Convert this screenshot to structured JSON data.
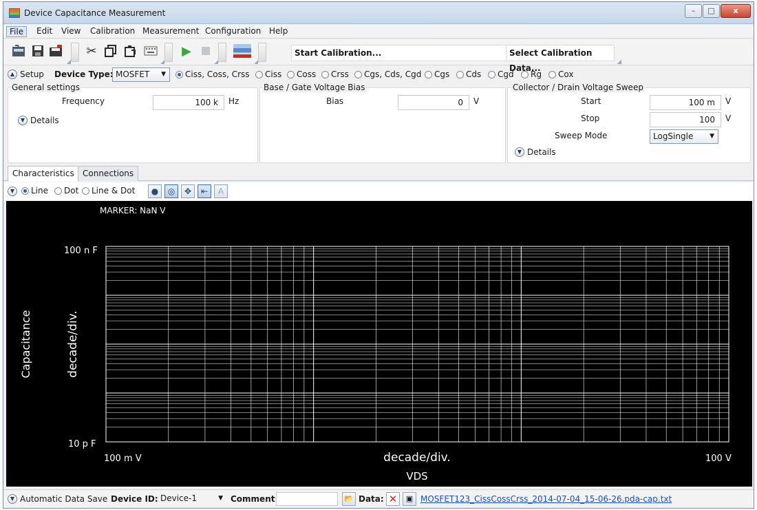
{
  "window": {
    "title": "Device Capacitance Measurement",
    "controls": [
      "–",
      "□",
      "x"
    ]
  },
  "menu": [
    "File",
    "Edit",
    "View",
    "Calibration",
    "Measurement",
    "Configuration",
    "Help"
  ],
  "toolbar": {
    "start_calibration": "Start Calibration...",
    "select_calibration_data": "Select Calibration Data...",
    "icons": [
      "open-folder-icon",
      "save-icon",
      "recent-files-icon",
      "cut-icon",
      "copy-icon",
      "paste-icon",
      "keyboard-icon",
      "run-icon",
      "stop-icon",
      "calibration-icon"
    ]
  },
  "setup": {
    "label": "Setup",
    "device_type_label": "Device Type:",
    "device_type_value": "MOSFET",
    "options": [
      {
        "label": "Ciss, Coss, Crss",
        "selected": true
      },
      {
        "label": "Ciss",
        "selected": false
      },
      {
        "label": "Coss",
        "selected": false
      },
      {
        "label": "Crss",
        "selected": false
      },
      {
        "label": "Cgs, Cds, Cgd",
        "selected": false
      },
      {
        "label": "Cgs",
        "selected": false
      },
      {
        "label": "Cds",
        "selected": false
      },
      {
        "label": "Cgd",
        "selected": false
      },
      {
        "label": "Rg",
        "selected": false
      },
      {
        "label": "Cox",
        "selected": false
      }
    ]
  },
  "general": {
    "title": "General settings",
    "frequency_label": "Frequency",
    "frequency_value": "100 k",
    "frequency_unit": "Hz",
    "details": "Details"
  },
  "bias": {
    "title": "Base / Gate Voltage Bias",
    "bias_label": "Bias",
    "bias_value": "0",
    "bias_unit": "V"
  },
  "sweep": {
    "title": "Collector / Drain Voltage Sweep",
    "start_label": "Start",
    "start_value": "100 m",
    "start_unit": "V",
    "stop_label": "Stop",
    "stop_value": "100",
    "stop_unit": "V",
    "mode_label": "Sweep Mode",
    "mode_value": "LogSingle",
    "details": "Details"
  },
  "tabs": [
    {
      "label": "Characteristics",
      "selected": true
    },
    {
      "label": "Connections",
      "selected": false
    }
  ],
  "plot_options": {
    "line": "Line",
    "dot": "Dot",
    "line_dot": "Line & Dot",
    "selected": "Line"
  },
  "chart_data": {
    "type": "line",
    "title": "",
    "marker": "MARKER: NaN V",
    "xlabel": "VDS",
    "ylabel": "Capacitance",
    "x_scale": "log",
    "y_scale": "log",
    "xlim": [
      0.1,
      100
    ],
    "ylim": [
      1e-11,
      1e-07
    ],
    "x_tick_labels": [
      "100 m V",
      "100 V"
    ],
    "y_tick_labels": [
      "100 n F",
      "10 p F"
    ],
    "x_div_label": "decade/div.",
    "y_div_label": "decade/div.",
    "grid": true,
    "background": "#000000",
    "grid_color": "#ffffff",
    "series": []
  },
  "status": {
    "auto_save_label": "Automatic Data Save",
    "device_id_label": "Device ID:",
    "device_id_value": "Device-1",
    "comment_label": "Comment:",
    "comment_value": "",
    "data_label": "Data:",
    "data_file": "MOSFET123_CissCossCrss_2014-07-04_15-06-26.pda-cap.txt"
  }
}
